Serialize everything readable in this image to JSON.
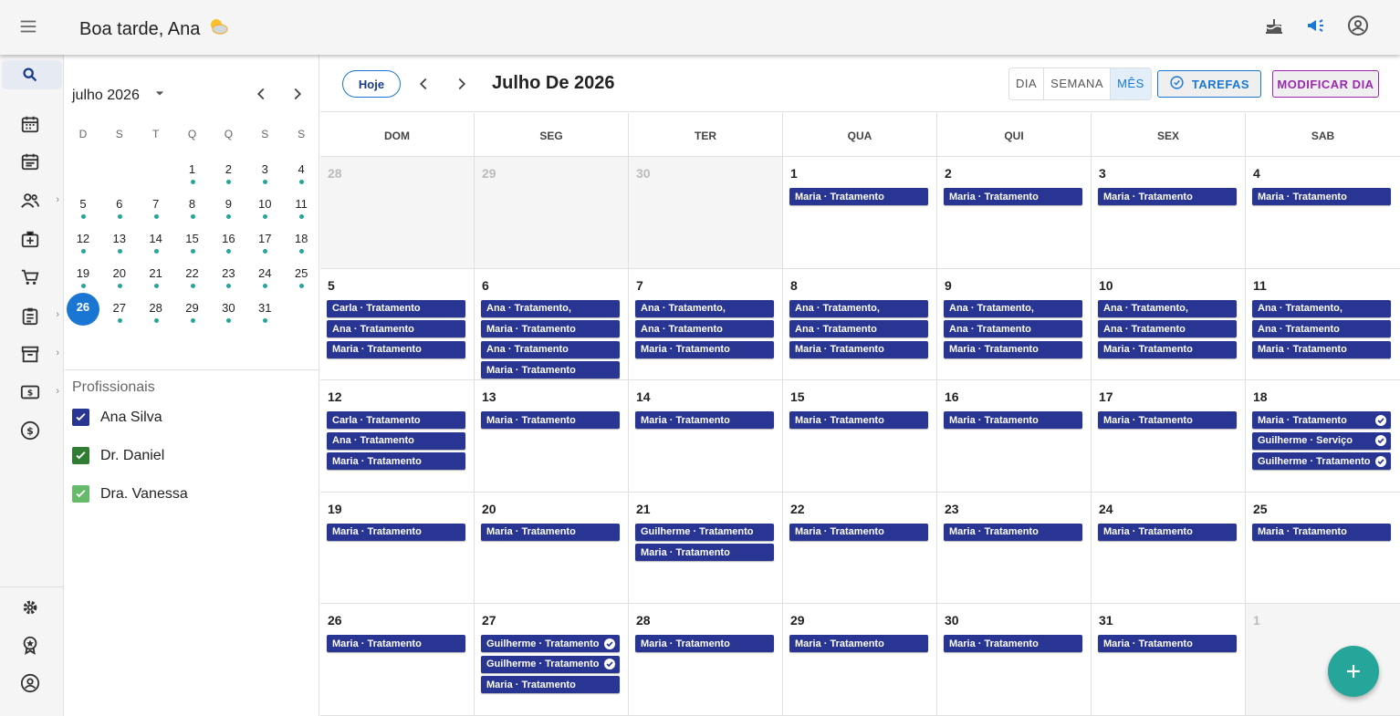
{
  "header": {
    "greeting": "Boa tarde, Ana",
    "greeting_icon": "sun-cloud-icon",
    "icons": [
      "cake-icon",
      "megaphone-icon",
      "account-circle-icon"
    ]
  },
  "rail": {
    "items": [
      "search-icon",
      "calendar-month-icon",
      "calendar-list-icon",
      "people-icon",
      "medical-bag-icon",
      "cart-icon",
      "clipboard-icon",
      "archive-icon",
      "cash-icon",
      "dollar-circle-icon"
    ],
    "bottom": [
      "settings-icon",
      "award-icon",
      "account-circle-icon"
    ]
  },
  "mini_calendar": {
    "month_label": "julho 2026",
    "weekday_headers": [
      "D",
      "S",
      "T",
      "Q",
      "Q",
      "S",
      "S"
    ],
    "weeks": [
      [
        "",
        "",
        "",
        "1",
        "2",
        "3",
        "4"
      ],
      [
        "5",
        "6",
        "7",
        "8",
        "9",
        "10",
        "11"
      ],
      [
        "12",
        "13",
        "14",
        "15",
        "16",
        "17",
        "18"
      ],
      [
        "19",
        "20",
        "21",
        "22",
        "23",
        "24",
        "25"
      ],
      [
        "26",
        "27",
        "28",
        "29",
        "30",
        "31",
        ""
      ]
    ],
    "today": "26"
  },
  "professionals": {
    "title": "Profissionais",
    "items": [
      {
        "name": "Ana Silva",
        "color": "#283593"
      },
      {
        "name": "Dr. Daniel",
        "color": "#2e7d32"
      },
      {
        "name": "Dra. Vanessa",
        "color": "#66bb6a"
      }
    ]
  },
  "toolbar": {
    "today_label": "Hoje",
    "title": "Julho De 2026",
    "views": [
      "DIA",
      "SEMANA",
      "MÊS"
    ],
    "selected_view": "MÊS",
    "tasks_label": "TAREFAS",
    "modify_label": "MODIFICAR DIA"
  },
  "calendar": {
    "weekdays": [
      "DOM",
      "SEG",
      "TER",
      "QUA",
      "QUI",
      "SEX",
      "SAB"
    ],
    "weeks": [
      [
        {
          "d": "28",
          "out": true,
          "ev": []
        },
        {
          "d": "29",
          "out": true,
          "ev": []
        },
        {
          "d": "30",
          "out": true,
          "ev": []
        },
        {
          "d": "1",
          "ev": [
            "Maria · Tratamento"
          ]
        },
        {
          "d": "2",
          "ev": [
            "Maria · Tratamento"
          ]
        },
        {
          "d": "3",
          "ev": [
            "Maria · Tratamento"
          ]
        },
        {
          "d": "4",
          "ev": [
            "Maria · Tratamento"
          ]
        }
      ],
      [
        {
          "d": "5",
          "ev": [
            "Carla · Tratamento",
            "Ana · Tratamento",
            "Maria · Tratamento"
          ]
        },
        {
          "d": "6",
          "ev": [
            "Ana · Tratamento,",
            "Maria · Tratamento",
            "Ana · Tratamento",
            "Maria · Tratamento"
          ]
        },
        {
          "d": "7",
          "ev": [
            "Ana · Tratamento,",
            "Ana · Tratamento",
            "Maria · Tratamento"
          ]
        },
        {
          "d": "8",
          "ev": [
            "Ana · Tratamento,",
            "Ana · Tratamento",
            "Maria · Tratamento"
          ]
        },
        {
          "d": "9",
          "ev": [
            "Ana · Tratamento,",
            "Ana · Tratamento",
            "Maria · Tratamento"
          ]
        },
        {
          "d": "10",
          "ev": [
            "Ana · Tratamento,",
            "Ana · Tratamento",
            "Maria · Tratamento"
          ]
        },
        {
          "d": "11",
          "ev": [
            "Ana · Tratamento,",
            "Ana · Tratamento",
            "Maria · Tratamento"
          ]
        }
      ],
      [
        {
          "d": "12",
          "ev": [
            "Carla · Tratamento",
            "Ana · Tratamento",
            "Maria · Tratamento"
          ]
        },
        {
          "d": "13",
          "ev": [
            "Maria · Tratamento"
          ]
        },
        {
          "d": "14",
          "ev": [
            "Maria · Tratamento"
          ]
        },
        {
          "d": "15",
          "ev": [
            "Maria · Tratamento"
          ]
        },
        {
          "d": "16",
          "ev": [
            "Maria · Tratamento"
          ]
        },
        {
          "d": "17",
          "ev": [
            "Maria · Tratamento"
          ]
        },
        {
          "d": "18",
          "ev": [
            "Maria · Tratamento",
            "Guilherme · Serviço",
            "Guilherme · Tratamento"
          ],
          "done": [
            true,
            true,
            true
          ]
        }
      ],
      [
        {
          "d": "19",
          "ev": [
            "Maria · Tratamento"
          ]
        },
        {
          "d": "20",
          "ev": [
            "Maria · Tratamento"
          ]
        },
        {
          "d": "21",
          "ev": [
            "Guilherme · Tratamento",
            "Maria · Tratamento"
          ]
        },
        {
          "d": "22",
          "ev": [
            "Maria · Tratamento"
          ]
        },
        {
          "d": "23",
          "ev": [
            "Maria · Tratamento"
          ]
        },
        {
          "d": "24",
          "ev": [
            "Maria · Tratamento"
          ]
        },
        {
          "d": "25",
          "ev": [
            "Maria · Tratamento"
          ]
        }
      ],
      [
        {
          "d": "26",
          "ev": [
            "Maria · Tratamento"
          ]
        },
        {
          "d": "27",
          "ev": [
            "Guilherme · Tratamento",
            "Guilherme · Tratamento",
            "Maria · Tratamento"
          ],
          "done": [
            true,
            true,
            false
          ]
        },
        {
          "d": "28",
          "ev": [
            "Maria · Tratamento"
          ]
        },
        {
          "d": "29",
          "ev": [
            "Maria · Tratamento"
          ]
        },
        {
          "d": "30",
          "ev": [
            "Maria · Tratamento"
          ]
        },
        {
          "d": "31",
          "ev": [
            "Maria · Tratamento"
          ]
        },
        {
          "d": "1",
          "out": true,
          "ev": []
        }
      ]
    ]
  },
  "colors": {
    "event": "#283593",
    "accent": "#1976d2",
    "fab": "#26a69a",
    "modify": "#9c27b0",
    "dot": "#26a69a"
  }
}
